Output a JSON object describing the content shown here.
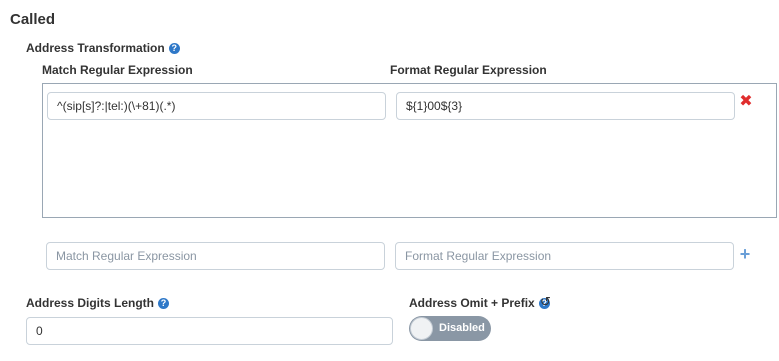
{
  "section": {
    "title": "Called"
  },
  "address_transformation": {
    "label": "Address Transformation",
    "help_icon": "question-circle-icon",
    "columns": {
      "match": "Match Regular Expression",
      "format": "Format Regular Expression"
    },
    "rules": [
      {
        "match": "^(sip[s]?:|tel:)(\\+81)(.*)",
        "format": "${1}00${3}",
        "remove_icon": "times-icon"
      }
    ],
    "new_rule": {
      "match_placeholder": "Match Regular Expression",
      "format_placeholder": "Format Regular Expression",
      "add_icon": "plus-icon"
    }
  },
  "address_digits_length": {
    "label": "Address Digits Length",
    "help_icon": "question-circle-icon",
    "value": "0"
  },
  "address_omit_prefix": {
    "label": "Address Omit + Prefix",
    "help_icon": "question-circle-icon",
    "reset_icon": "undo-icon",
    "toggle_state": "Disabled",
    "enabled": false
  },
  "colors": {
    "remove": "#e02d2d",
    "add": "#6a9fd8",
    "help": "#2e78c8",
    "toggle_off": "#8a97a5"
  }
}
